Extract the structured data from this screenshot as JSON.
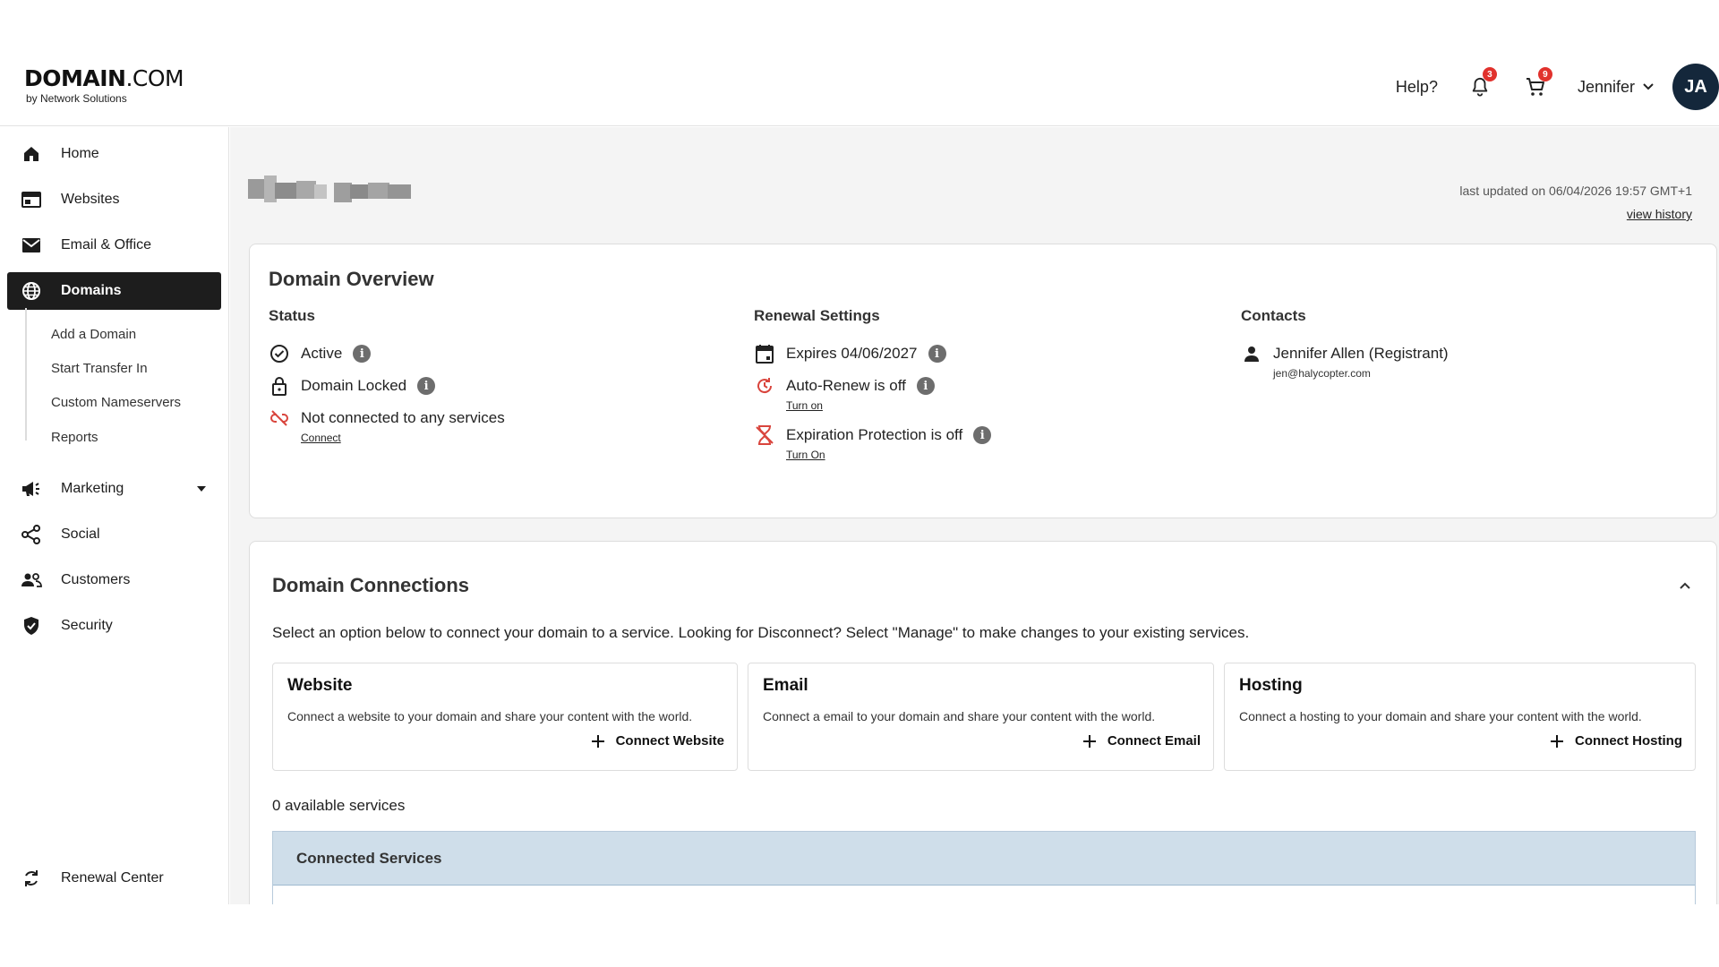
{
  "brand": {
    "name_bold": "DOMAIN",
    "name_rest": ".COM",
    "tagline": "by Network Solutions"
  },
  "header": {
    "help": "Help?",
    "notifications_count": "3",
    "cart_count": "9",
    "user_name": "Jennifer",
    "avatar_initials": "JA",
    "badge_color": "#e1322d",
    "avatar_color": "#14273b"
  },
  "sidebar": {
    "items": [
      {
        "label": "Home",
        "icon": "home-icon"
      },
      {
        "label": "Websites",
        "icon": "websites-icon"
      },
      {
        "label": "Email & Office",
        "icon": "mail-icon"
      },
      {
        "label": "Domains",
        "icon": "globe-icon",
        "active": true
      },
      {
        "label": "Marketing",
        "icon": "megaphone-icon"
      },
      {
        "label": "Social",
        "icon": "share-icon"
      },
      {
        "label": "Customers",
        "icon": "people-icon"
      },
      {
        "label": "Security",
        "icon": "shield-icon"
      }
    ],
    "domain_subitems": [
      "Add a Domain",
      "Start Transfer In",
      "Custom Nameservers",
      "Reports"
    ],
    "renewal": "Renewal Center"
  },
  "main": {
    "last_updated": "last updated on 06/04/2026 19:57 GMT+1",
    "view_history": "view history",
    "overview": {
      "title": "Domain Overview",
      "status": {
        "heading": "Status",
        "active": "Active",
        "locked": "Domain Locked",
        "not_connected": "Not connected to any services",
        "connect_link": "Connect"
      },
      "renewal": {
        "heading": "Renewal Settings",
        "expires": "Expires 04/06/2027",
        "auto_renew": "Auto-Renew is off",
        "auto_renew_link": "Turn on",
        "protection": "Expiration Protection is off",
        "protection_link": "Turn On"
      },
      "contacts": {
        "heading": "Contacts",
        "name": "Jennifer Allen (Registrant)",
        "email": "jen@halycopter.com"
      }
    },
    "connections": {
      "title": "Domain Connections",
      "description": "Select an option below to connect your domain to a service. Looking for Disconnect? Select \"Manage\" to make changes to your existing services.",
      "services": [
        {
          "title": "Website",
          "desc": "Connect a website to your domain and share your content with the world.",
          "button": "Connect Website"
        },
        {
          "title": "Email",
          "desc": "Connect a email to your domain and share your content with the world.",
          "button": "Connect Email"
        },
        {
          "title": "Hosting",
          "desc": "Connect a hosting to your domain and share your content with the world.",
          "button": "Connect Hosting"
        }
      ],
      "available": "0 available services",
      "connected_heading": "Connected Services"
    }
  },
  "colors": {
    "warning_red": "#d9453d",
    "connected_header_bg": "#cfdeea"
  }
}
